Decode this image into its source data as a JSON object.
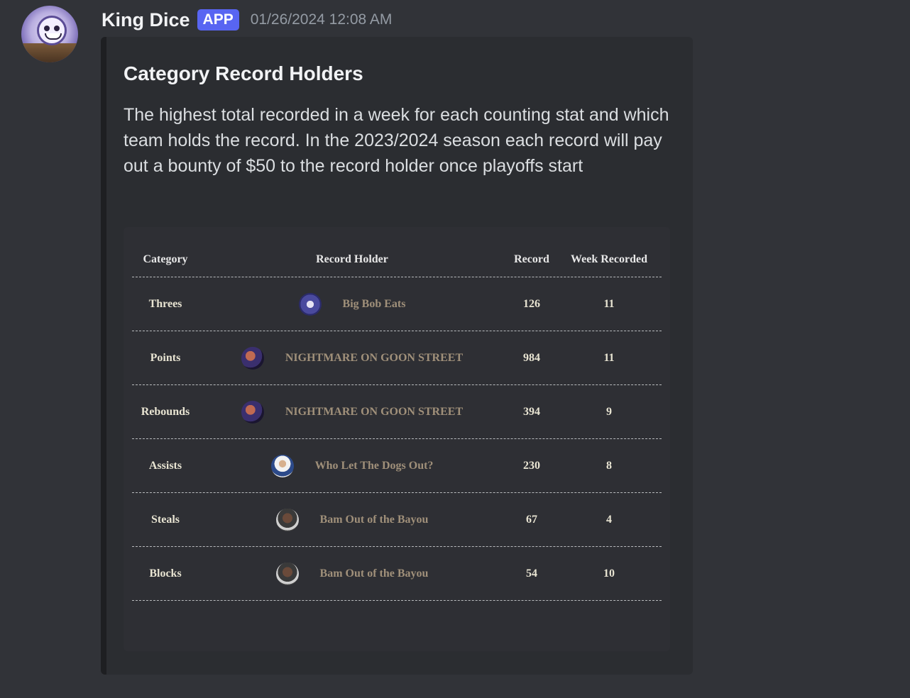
{
  "message": {
    "author": "King Dice",
    "badge": "APP",
    "timestamp": "01/26/2024 12:08 AM"
  },
  "embed": {
    "title": "Category Record Holders",
    "description": "The highest total recorded in a week for each counting stat and which team holds the record. In the 2023/2024 season each record will pay out a bounty of $50 to the record holder once playoffs start"
  },
  "table": {
    "headers": {
      "category": "Category",
      "holder": "Record Holder",
      "record": "Record",
      "week": "Week Recorded"
    },
    "rows": [
      {
        "category": "Threes",
        "holder": "Big Bob Eats",
        "record": "126",
        "week": "11",
        "avatar_icon": "team-logo-icon"
      },
      {
        "category": "Points",
        "holder": "NIGHTMARE ON GOON STREET",
        "record": "984",
        "week": "11",
        "avatar_icon": "team-avatar-icon"
      },
      {
        "category": "Rebounds",
        "holder": "NIGHTMARE ON GOON STREET",
        "record": "394",
        "week": "9",
        "avatar_icon": "team-avatar-icon"
      },
      {
        "category": "Assists",
        "holder": "Who Let The Dogs Out?",
        "record": "230",
        "week": "8",
        "avatar_icon": "team-avatar-icon"
      },
      {
        "category": "Steals",
        "holder": "Bam Out of the Bayou",
        "record": "67",
        "week": "4",
        "avatar_icon": "team-avatar-icon"
      },
      {
        "category": "Blocks",
        "holder": "Bam Out of the Bayou",
        "record": "54",
        "week": "10",
        "avatar_icon": "team-avatar-icon"
      }
    ]
  },
  "colors": {
    "background": "#313338",
    "embed_background": "#2b2d31",
    "badge": "#5865f2",
    "team_name": "#a0907a"
  }
}
